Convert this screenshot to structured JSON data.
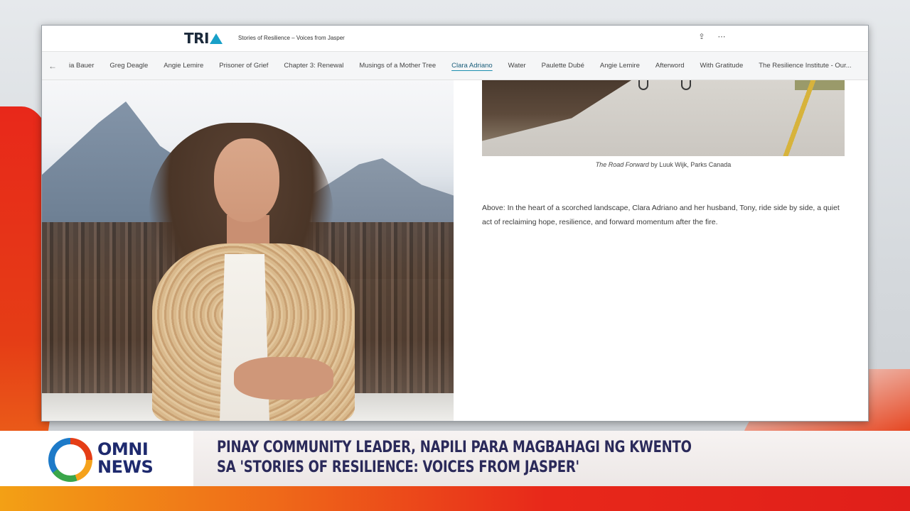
{
  "site": {
    "logo_text": "TRI",
    "title": "Stories of Resilience – Voices from Jasper",
    "share_icon": "share-icon",
    "more_icon": "more-icon"
  },
  "nav": {
    "back_icon": "chevron-left-icon",
    "items": [
      {
        "label": "ia Bauer",
        "active": false
      },
      {
        "label": "Greg Deagle",
        "active": false
      },
      {
        "label": "Angie Lemire",
        "active": false
      },
      {
        "label": "Prisoner of Grief",
        "active": false
      },
      {
        "label": "Chapter 3: Renewal",
        "active": false
      },
      {
        "label": "Musings of a Mother Tree",
        "active": false
      },
      {
        "label": "Clara Adriano",
        "active": true
      },
      {
        "label": "Water",
        "active": false
      },
      {
        "label": "Paulette Dubé",
        "active": false
      },
      {
        "label": "Angie Lemire",
        "active": false
      },
      {
        "label": "Afterword",
        "active": false
      },
      {
        "label": "With Gratitude",
        "active": false
      },
      {
        "label": "The Resilience Institute - Our...",
        "active": false
      }
    ]
  },
  "article": {
    "caption_title": "The Road Forward",
    "caption_credit": " by Luuk Wijk, Parks Canada",
    "body": "Above: In the heart of a scorched landscape, Clara Adriano and her husband, Tony, ride side by side, a quiet act of reclaiming hope, resilience, and forward momentum after the fire."
  },
  "lower_third": {
    "brand_line1": "OMNI",
    "brand_line2": "NEWS",
    "headline_line1": "PINAY COMMUNITY LEADER, NAPILI PARA MAGBAHAGI NG KWENTO",
    "headline_line2": "SA 'STORIES OF RESILIENCE: VOICES FROM JASPER'"
  }
}
